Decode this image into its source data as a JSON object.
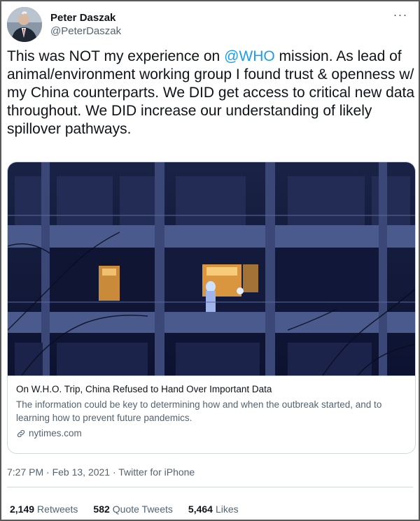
{
  "author": {
    "display_name": "Peter Daszak",
    "handle": "@PeterDaszak",
    "avatar_icon": "user-avatar-icon"
  },
  "more_icon": "more-horizontal-icon",
  "tweet": {
    "text_part1": "This was NOT my experience on ",
    "mention": "@WHO",
    "text_part2": " mission. As lead of animal/environment working group I found trust & openness w/ my China counterparts. We DID get access to critical new data throughout. We DID increase our understanding of likely spillover pathways."
  },
  "card": {
    "image_icon": "hotel-night-photo",
    "title": "On W.H.O. Trip, China Refused to Hand Over Important Data",
    "description": "The information could be key to determining how and when the outbreak started, and to learning how to prevent future pandemics.",
    "domain": "nytimes.com",
    "domain_icon": "link-icon"
  },
  "meta": "7:27 PM · Feb 13, 2021 · Twitter for iPhone",
  "stats": {
    "retweets_count": "2,149",
    "retweets_label": "Retweets",
    "quotes_count": "582",
    "quotes_label": "Quote Tweets",
    "likes_count": "5,464",
    "likes_label": "Likes"
  },
  "colors": {
    "accent": "#1d9bf0",
    "text": "#0f1419",
    "secondary": "#536471",
    "border": "#cfd9de"
  }
}
